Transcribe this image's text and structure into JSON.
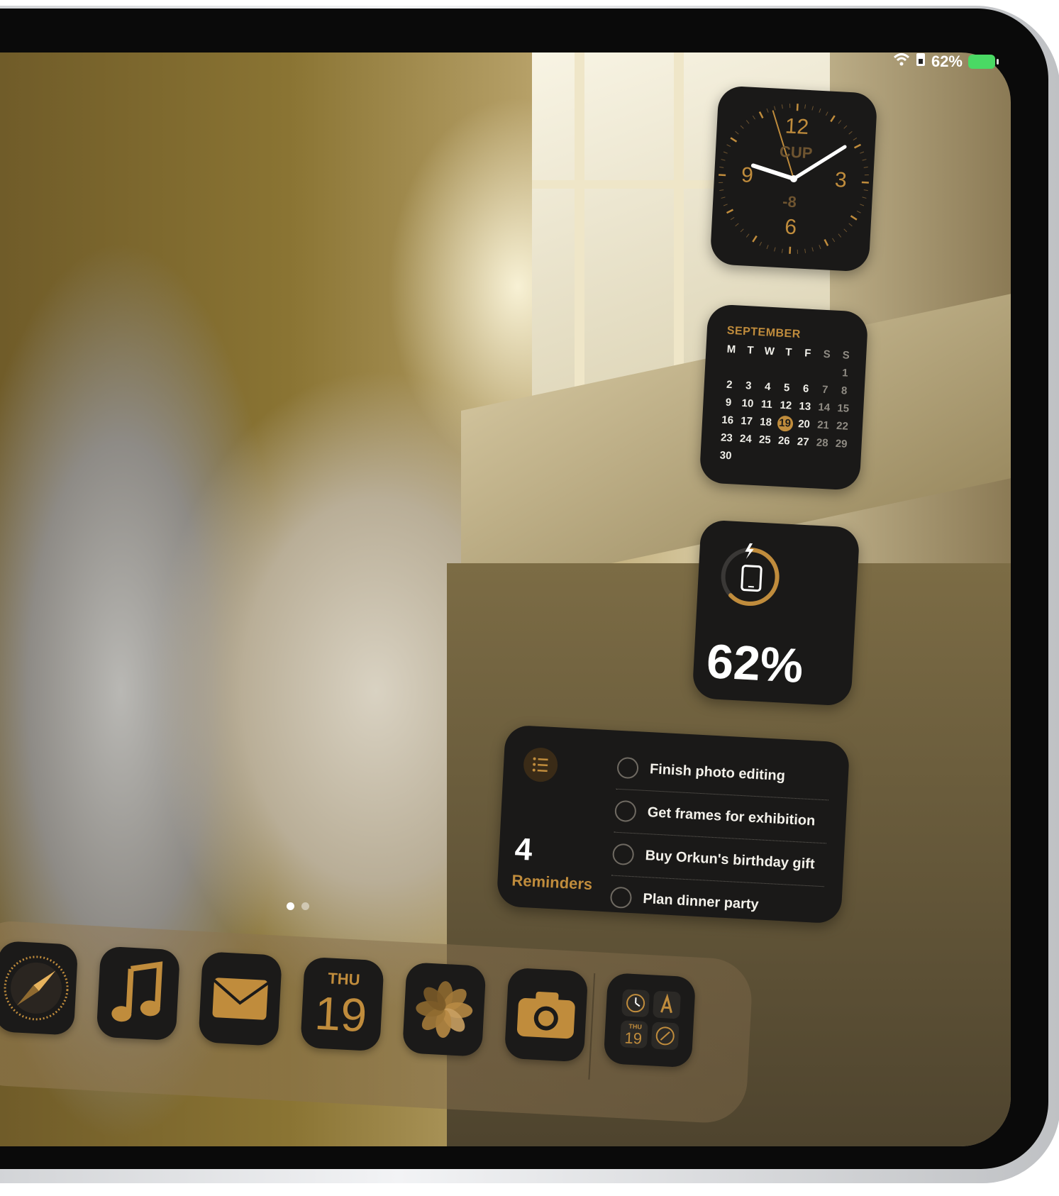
{
  "status_bar": {
    "battery_percent": "62%",
    "battery_level": 0.62,
    "icons": [
      "wifi-icon",
      "sim-icon",
      "charging-battery-icon"
    ]
  },
  "clock_widget": {
    "numerals": [
      "12",
      "3",
      "6",
      "9"
    ],
    "city": "CUP",
    "offset": "-8"
  },
  "calendar_widget": {
    "month": "SEPTEMBER",
    "weekdays": [
      "M",
      "T",
      "W",
      "T",
      "F",
      "S",
      "S"
    ],
    "rows": [
      [
        "",
        "",
        "",
        "",
        "",
        "",
        "1"
      ],
      [
        "2",
        "3",
        "4",
        "5",
        "6",
        "7",
        "8"
      ],
      [
        "9",
        "10",
        "11",
        "12",
        "13",
        "14",
        "15"
      ],
      [
        "16",
        "17",
        "18",
        "19",
        "20",
        "21",
        "22"
      ],
      [
        "23",
        "24",
        "25",
        "26",
        "27",
        "28",
        "29"
      ],
      [
        "30",
        "",
        "",
        "",
        "",
        "",
        ""
      ]
    ],
    "today": "19"
  },
  "battery_widget": {
    "percent": "62%",
    "level": 0.62,
    "device_icon": "ipad-icon"
  },
  "reminders_widget": {
    "count": "4",
    "title": "Reminders",
    "items": [
      "Finish photo editing",
      "Get frames for exhibition",
      "Buy Orkun's birthday gift",
      "Plan dinner party"
    ]
  },
  "page_dots": {
    "count": 2,
    "active": 0
  },
  "dock": {
    "apps": [
      "safari-icon",
      "music-icon",
      "mail-icon",
      "calendar-icon",
      "photos-icon",
      "camera-icon"
    ],
    "calendar_day": "THU",
    "calendar_date": "19",
    "folder_calendar_day": "THU",
    "folder_calendar_date": "19",
    "folder_apps": [
      "clock-icon",
      "app-store-icon",
      "calendar-icon",
      "safari-icon"
    ]
  },
  "colors": {
    "accent": "#c08c3c",
    "widget_bg": "#1a1918",
    "battery_green": "#4ad964"
  }
}
